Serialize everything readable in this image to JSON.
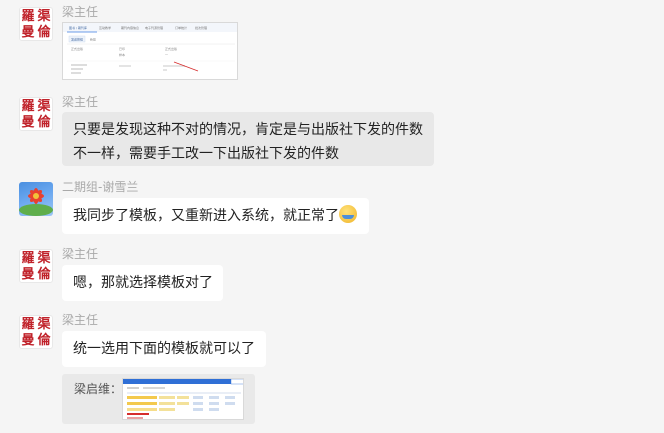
{
  "seal_chars": [
    "羅",
    "渠",
    "曼",
    "倫"
  ],
  "seal_color": "#c0222a",
  "messages": [
    {
      "sender": "梁主任",
      "avatar": "seal",
      "type": "image",
      "image": {
        "tabs": [
          "图书 / 期刊库",
          "互动教学",
          "期刊内容信息",
          "电子刊源管理",
          "订单统计",
          "批次管理"
        ],
        "subtabs": [
          "发送按钮",
          "新建"
        ],
        "fields": [
          "正式出版",
          "已印",
          "样本",
          "正式出版",
          "一"
        ]
      }
    },
    {
      "sender": "梁主任",
      "avatar": "seal",
      "type": "text",
      "lines": [
        "只要是发现这种不对的情况，肯定是与出版社下发的件数",
        "不一样，需要手工改一下出版社下发的件数"
      ]
    },
    {
      "sender": "二期组-谢雪兰",
      "avatar": "photo",
      "type": "text",
      "lines": [
        "我同步了模板，又重新进入系统，就正常了"
      ],
      "emoji": "tears-of-joy-emoji"
    },
    {
      "sender": "梁主任",
      "avatar": "seal",
      "type": "text",
      "lines": [
        "嗯，那就选择模板对了"
      ]
    },
    {
      "sender": "梁主任",
      "avatar": "seal",
      "type": "text",
      "lines": [
        "统一选用下面的模板就可以了"
      ]
    }
  ],
  "quote": {
    "label": "梁启维："
  }
}
